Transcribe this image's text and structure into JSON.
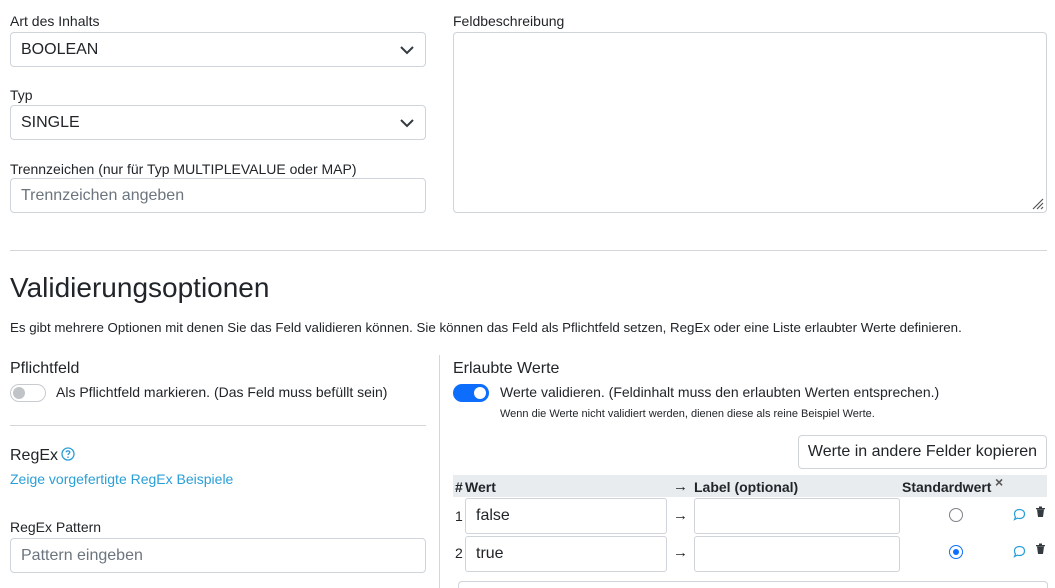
{
  "left_form": {
    "content_type": {
      "label": "Art des Inhalts",
      "value": "BOOLEAN"
    },
    "type": {
      "label": "Typ",
      "value": "SINGLE"
    },
    "separator": {
      "label": "Trennzeichen (nur für Typ MULTIPLEVALUE oder MAP)",
      "placeholder": "Trennzeichen angeben"
    }
  },
  "description": {
    "label": "Feldbeschreibung"
  },
  "validation": {
    "heading": "Validierungsoptionen",
    "intro": "Es gibt mehrere Optionen mit denen Sie das Feld validieren können. Sie können das Feld als Pflichtfeld setzen, RegEx oder eine Liste erlaubter Werte definieren.",
    "required": {
      "title": "Pflichtfeld",
      "toggle_label": "Als Pflichtfeld markieren. (Das Feld muss befüllt sein)",
      "enabled": false
    },
    "regex": {
      "title": "RegEx",
      "examples_link": "Zeige vorgefertigte RegEx Beispiele",
      "pattern_label": "RegEx Pattern",
      "pattern_placeholder": "Pattern eingeben"
    },
    "allowed": {
      "title": "Erlaubte Werte",
      "toggle_label": "Werte validieren. (Feldinhalt muss den erlaubten Werten entsprechen.)",
      "enabled": true,
      "hint": "Wenn die Werte nicht validiert werden, dienen diese als reine Beispiel Werte.",
      "copy_button": "Werte in andere Felder kopieren",
      "columns": {
        "num": "#",
        "value": "Wert",
        "arrow": "→",
        "label": "Label (optional)",
        "default": "Standardwert",
        "clear": "×"
      },
      "rows": [
        {
          "num": "1",
          "value": "false",
          "arrow": "→",
          "label": "",
          "default": false
        },
        {
          "num": "2",
          "value": "true",
          "arrow": "→",
          "label": "",
          "default": true
        }
      ]
    }
  },
  "colors": {
    "accent": "#0d6efd",
    "link": "#2a9fd6"
  }
}
